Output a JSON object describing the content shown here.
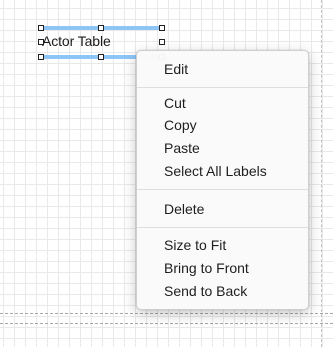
{
  "canvas": {
    "selected_label": {
      "text": "Actor Table"
    }
  },
  "context_menu": {
    "groups": [
      [
        "Edit"
      ],
      [
        "Cut",
        "Copy",
        "Paste",
        "Select All Labels"
      ],
      [
        "Delete"
      ],
      [
        "Size to Fit",
        "Bring to Front",
        "Send to Back"
      ]
    ]
  }
}
